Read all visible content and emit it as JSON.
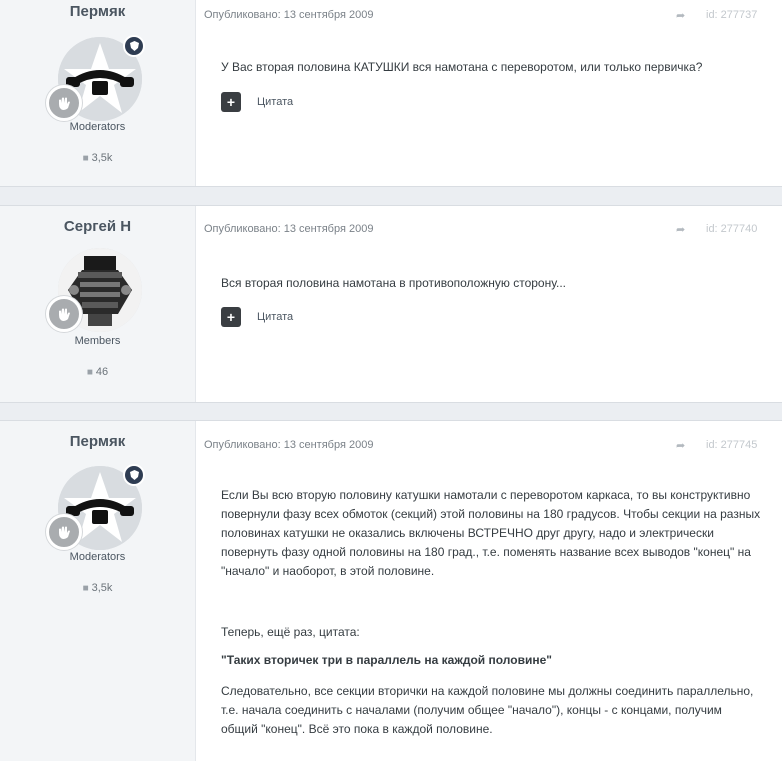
{
  "posts": [
    {
      "author": "Пермяк",
      "group": "Moderators",
      "reputation": "3,5k",
      "published": "Опубликовано: 13 сентября 2009",
      "post_id": "id: 277737",
      "paragraphs": [
        "У Вас вторая половина КАТУШКИ вся намотана с переворотом, или только первичка?"
      ],
      "quote_label": "Цитата"
    },
    {
      "author": "Сергей Н",
      "group": "Members",
      "reputation": "46",
      "published": "Опубликовано: 13 сентября 2009",
      "post_id": "id: 277740",
      "paragraphs": [
        "Вся вторая половина намотана в противоположную сторону..."
      ],
      "quote_label": "Цитата"
    },
    {
      "author": "Пермяк",
      "group": "Moderators",
      "reputation": "3,5k",
      "published": "Опубликовано: 13 сентября 2009",
      "post_id": "id: 277745",
      "paragraphs": [
        "Если Вы всю вторую половину катушки намотали с переворотом каркаса, то вы конструктивно повернули фазу всех обмоток (секций) этой половины на 180 градусов. Чтобы секции на разных половинах катушки не оказались включены ВСТРЕЧНО друг другу, надо и электрически повернуть фазу одной половины на 180 град., т.е. поменять название всех выводов \"конец\" на \"начало\" и наоборот, в этой половине.",
        "Теперь, ещё раз, цитата:",
        "\"Таких вторичек три в параллель на каждой половине\"",
        "Следовательно, все секции вторички на каждой половине мы должны соединить параллельно, т.е. начала соединить с началами (получим общее \"начало\"), концы - с концами, получим общий \"конец\". Всё это пока в каждой половине."
      ]
    }
  ],
  "colors": {
    "page_bg": "#ebeef2",
    "author_bg": "#f3f5f7",
    "mod_badge": "#2e3c52",
    "quote_button": "#3a3e42"
  },
  "icons": [
    "share-icon",
    "comment-icon",
    "plus-icon",
    "moderator-shield-icon",
    "rank-hand-icon"
  ]
}
